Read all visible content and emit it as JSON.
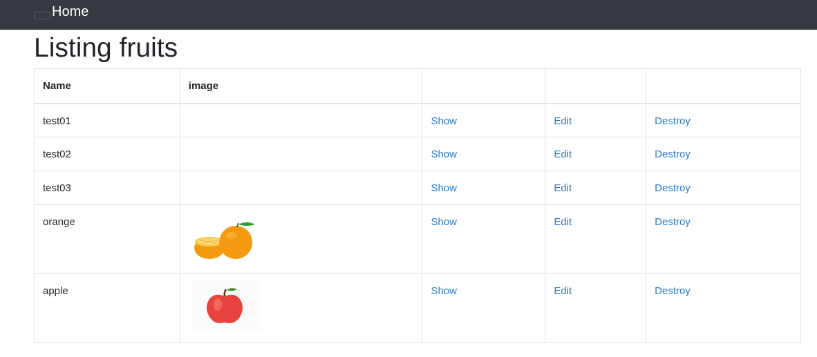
{
  "navbar": {
    "home_label": "Home",
    "background": "#343a40"
  },
  "page": {
    "title": "Listing fruits"
  },
  "table": {
    "headers": [
      "Name",
      "image",
      "",
      "",
      ""
    ],
    "rows": [
      {
        "name": "test01",
        "image": "",
        "show": "Show",
        "edit": "Edit",
        "destroy": "Destroy"
      },
      {
        "name": "test02",
        "image": "",
        "show": "Show",
        "edit": "Edit",
        "destroy": "Destroy"
      },
      {
        "name": "test03",
        "image": "",
        "show": "Show",
        "edit": "Edit",
        "destroy": "Destroy"
      },
      {
        "name": "orange",
        "image": "orange-image",
        "show": "Show",
        "edit": "Edit",
        "destroy": "Destroy"
      },
      {
        "name": "apple",
        "image": "apple-image",
        "show": "Show",
        "edit": "Edit",
        "destroy": "Destroy"
      }
    ]
  },
  "colors": {
    "link": "#2a7ac9",
    "border": "#dee2e6",
    "text": "#212529"
  }
}
